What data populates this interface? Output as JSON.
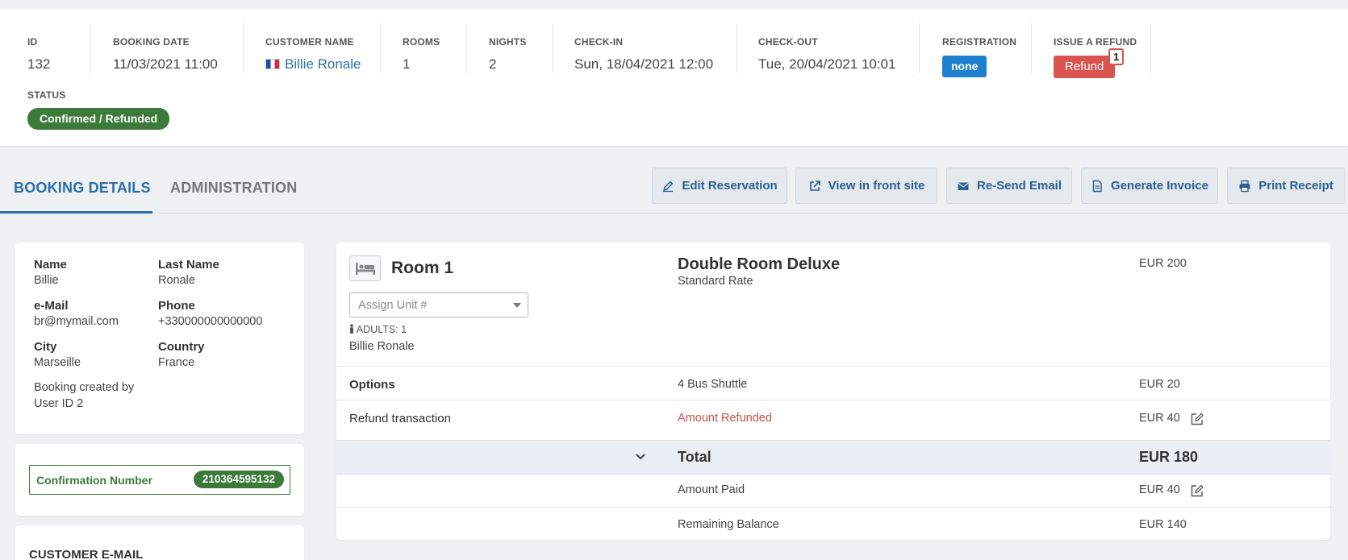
{
  "summary": {
    "id_label": "ID",
    "id_value": "132",
    "booking_date_label": "BOOKING DATE",
    "booking_date_value": "11/03/2021 11:00",
    "customer_label": "CUSTOMER NAME",
    "customer_value": "Billie Ronale",
    "rooms_label": "ROOMS",
    "rooms_value": "1",
    "nights_label": "NIGHTS",
    "nights_value": "2",
    "checkin_label": "CHECK-IN",
    "checkin_value": "Sun, 18/04/2021 12:00",
    "checkout_label": "CHECK-OUT",
    "checkout_value": "Tue, 20/04/2021 10:01",
    "registration_label": "REGISTRATION",
    "registration_value": "none",
    "refund_label": "ISSUE A REFUND",
    "refund_button": "Refund",
    "refund_count": "1",
    "status_label": "STATUS",
    "status_value": "Confirmed / Refunded"
  },
  "tabs": {
    "booking_details": "BOOKING DETAILS",
    "administration": "ADMINISTRATION"
  },
  "toolbar": {
    "edit": "Edit Reservation",
    "view": "View in front site",
    "resend": "Re-Send Email",
    "invoice": "Generate Invoice",
    "print": "Print Receipt"
  },
  "guest": {
    "name_label": "Name",
    "name_value": "Billie",
    "lastname_label": "Last Name",
    "lastname_value": "Ronale",
    "email_label": "e-Mail",
    "email_value": "br@mymail.com",
    "phone_label": "Phone",
    "phone_value": "+330000000000000",
    "city_label": "City",
    "city_value": "Marseille",
    "country_label": "Country",
    "country_value": "France",
    "created_line1": "Booking created by",
    "created_line2": "User ID 2"
  },
  "confirmation": {
    "label": "Confirmation Number",
    "number": "210364595132"
  },
  "customer_email": {
    "heading": "CUSTOMER E-MAIL"
  },
  "room": {
    "title": "Room 1",
    "unit_placeholder": "Assign Unit #",
    "adults": "ADULTS: 1",
    "guest_name": "Billie Ronale",
    "room_type": "Double Room Deluxe",
    "rate": "Standard Rate",
    "price": "EUR 200"
  },
  "lines": {
    "options_label": "Options",
    "options_desc": "4 Bus Shuttle",
    "options_amount": "EUR 20",
    "refund_label": "Refund transaction",
    "refund_desc": "Amount Refunded",
    "refund_amount": "EUR 40",
    "total_label": "Total",
    "total_amount": "EUR 180",
    "paid_label": "Amount Paid",
    "paid_amount": "EUR 40",
    "balance_label": "Remaining Balance",
    "balance_amount": "EUR 140"
  },
  "colors": {
    "primary": "#2a6fad",
    "success": "#3c7a3a",
    "danger": "#d9534f",
    "info": "#1f7fd1"
  }
}
